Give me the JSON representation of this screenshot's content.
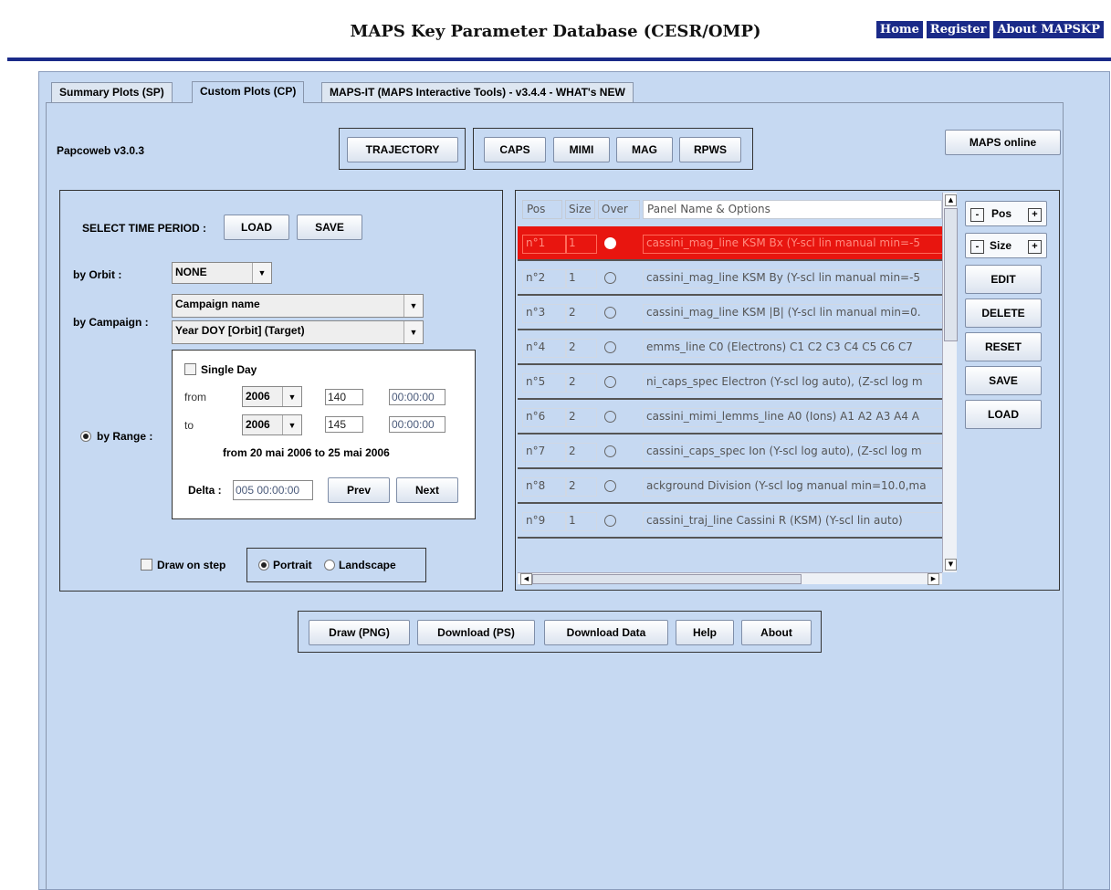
{
  "site": {
    "title": "MAPS Key Parameter Database (CESR/OMP)",
    "links": [
      "Home",
      "Register",
      "About MAPSKP"
    ]
  },
  "tabs": [
    "Summary Plots (SP)",
    "Custom Plots (CP)",
    "MAPS-IT (MAPS Interactive Tools) - v3.4.4 - WHAT's NEW"
  ],
  "active_tab": "Custom Plots (CP)",
  "version": "Papcoweb v3.0.3",
  "instruments": {
    "trajectory": "TRAJECTORY",
    "buttons": [
      "CAPS",
      "MIMI",
      "MAG",
      "RPWS"
    ]
  },
  "maps_online": "MAPS online",
  "time": {
    "select_label": "SELECT TIME PERIOD :",
    "load": "LOAD",
    "save": "SAVE",
    "by_orbit_label": "by Orbit :",
    "orbit_value": "NONE",
    "by_campaign_label": "by Campaign :",
    "campaign_value": "Campaign name",
    "campaign_format": "Year DOY [Orbit] (Target)",
    "by_range_label": "by Range :",
    "single_day": "Single Day",
    "from_label": "from",
    "to_label": "to",
    "from_year": "2006",
    "from_doy": "140",
    "from_time": "00:00:00",
    "to_year": "2006",
    "to_doy": "145",
    "to_time": "00:00:00",
    "summary": "from 20 mai 2006  to 25 mai 2006",
    "delta_label": "Delta :",
    "delta_value": "005 00:00:00",
    "prev": "Prev",
    "next": "Next",
    "draw_on_step": "Draw on step",
    "portrait": "Portrait",
    "landscape": "Landscape"
  },
  "panel_table": {
    "headers": [
      "Pos",
      "Size",
      "Over",
      "Panel Name & Options"
    ],
    "rows": [
      {
        "pos": "n°1",
        "size": "1",
        "name": "cassini_mag_line KSM Bx  (Y-scl lin manual min=-5",
        "selected": true
      },
      {
        "pos": "n°2",
        "size": "1",
        "name": "cassini_mag_line KSM By  (Y-scl lin manual min=-5",
        "selected": false
      },
      {
        "pos": "n°3",
        "size": "2",
        "name": "cassini_mag_line KSM |B|  (Y-scl lin manual min=0.",
        "selected": false
      },
      {
        "pos": "n°4",
        "size": "2",
        "name": "emms_line  C0 (Electrons) C1 C2 C3 C4 C5 C6 C7",
        "selected": false
      },
      {
        "pos": "n°5",
        "size": "2",
        "name": "ni_caps_spec Electron  (Y-scl log auto), (Z-scl log m",
        "selected": false
      },
      {
        "pos": "n°6",
        "size": "2",
        "name": "cassini_mimi_lemms_line  A0 (Ions) A1 A2 A3 A4 A",
        "selected": false
      },
      {
        "pos": "n°7",
        "size": "2",
        "name": "cassini_caps_spec Ion  (Y-scl log auto), (Z-scl log m",
        "selected": false
      },
      {
        "pos": "n°8",
        "size": "2",
        "name": "ackground Division  (Y-scl log manual min=10.0,ma",
        "selected": false
      },
      {
        "pos": "n°9",
        "size": "1",
        "name": "cassini_traj_line Cassini R (KSM)  (Y-scl lin auto)",
        "selected": false
      }
    ]
  },
  "panel_controls": {
    "pos": "Pos",
    "size": "Size",
    "minus": "-",
    "plus": "+",
    "edit": "EDIT",
    "delete": "DELETE",
    "reset": "RESET",
    "save": "SAVE",
    "load": "LOAD"
  },
  "bottom_buttons": [
    "Draw (PNG)",
    "Download (PS)",
    "Download Data",
    "Help",
    "About"
  ],
  "colors": {
    "navy": "#1a2a88",
    "app_bg": "#c6d9f2",
    "selected_row": "#e8150f"
  }
}
